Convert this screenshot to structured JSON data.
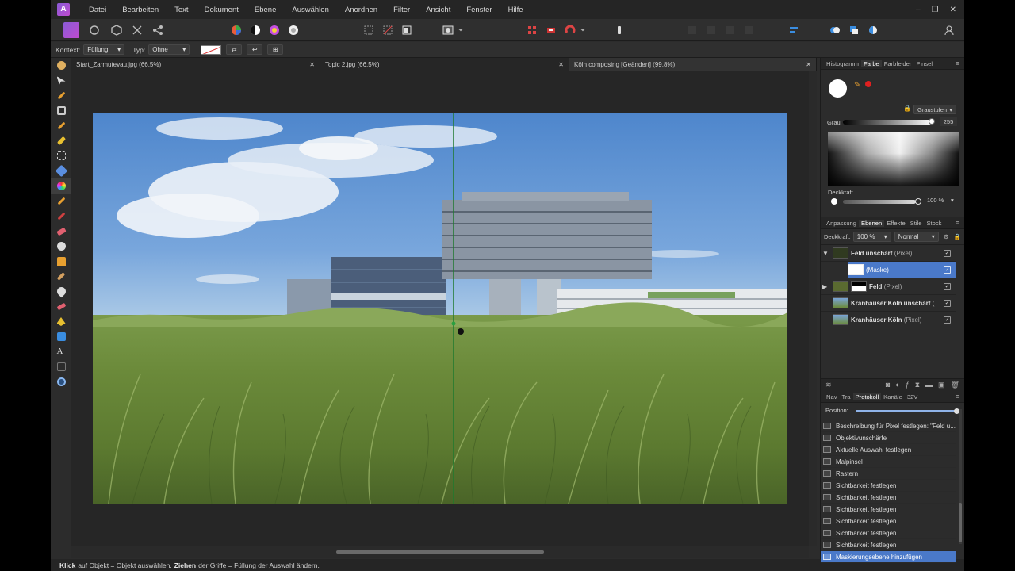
{
  "menu": {
    "items": [
      "Datei",
      "Bearbeiten",
      "Text",
      "Dokument",
      "Ebene",
      "Auswählen",
      "Anordnen",
      "Filter",
      "Ansicht",
      "Fenster",
      "Hilfe"
    ]
  },
  "window": {
    "minimize": "–",
    "restore": "❐",
    "close": "✕"
  },
  "context": {
    "kontext_label": "Kontext:",
    "kontext_value": "Füllung",
    "typ_label": "Typ:",
    "typ_value": "Ohne"
  },
  "tabs": [
    {
      "label": "Start_Zarmutevau.jpg (66.5%)",
      "close": "✕"
    },
    {
      "label": "Topic 2.jpg (66.5%)",
      "close": "✕"
    },
    {
      "label": "Köln composing [Geändert] (99.8%)",
      "close": "✕"
    }
  ],
  "status": {
    "bold1": "Klick",
    "text1": "auf Objekt = Objekt auswählen.",
    "bold2": "Ziehen",
    "text2": "der Griffe = Füllung der Auswahl ändern."
  },
  "color_panel": {
    "tabs": [
      "Histogramm",
      "Farbe",
      "Farbfelder",
      "Pinsel"
    ],
    "active_tab": "Farbe",
    "mode": "Graustufen",
    "grau_label": "Grau:",
    "grau_value": "255",
    "deckkraft_label": "Deckkraft",
    "deckkraft_value": "100 %"
  },
  "layers_panel": {
    "tabs": [
      "Anpassung",
      "Ebenen",
      "Effekte",
      "Stile",
      "Stock"
    ],
    "active_tab": "Ebenen",
    "opacity_label": "Deckkraft:",
    "opacity_value": "100 %",
    "blend_mode": "Normal",
    "layers": [
      {
        "name": "Feld unscharf",
        "type": "(Pixel)",
        "expanded": true
      },
      {
        "name": "",
        "type": "(Maske)",
        "selected": true
      },
      {
        "name": "Feld",
        "type": "(Pixel)"
      },
      {
        "name": "Kranhäuser Köln unscharf",
        "type": "(..."
      },
      {
        "name": "Kranhäuser Köln",
        "type": "(Pixel)"
      }
    ]
  },
  "history_panel": {
    "tabs": [
      "Nav",
      "Tra",
      "Protokoll",
      "Kanäle",
      "32V"
    ],
    "active_tab": "Protokoll",
    "position_label": "Position:",
    "items": [
      "Beschreibung für Pixel festlegen: \"Feld u...",
      "Objektivunschärfe",
      "Aktuelle Auswahl festlegen",
      "Malpinsel",
      "Rastern",
      "Sichtbarkeit festlegen",
      "Sichtbarkeit festlegen",
      "Sichtbarkeit festlegen",
      "Sichtbarkeit festlegen",
      "Sichtbarkeit festlegen",
      "Sichtbarkeit festlegen",
      "Maskierungsebene hinzufügen"
    ]
  },
  "colors": {
    "accent": "#4a79c9",
    "brand": "#9b5de5",
    "fill_line": "#1f7a2e"
  }
}
